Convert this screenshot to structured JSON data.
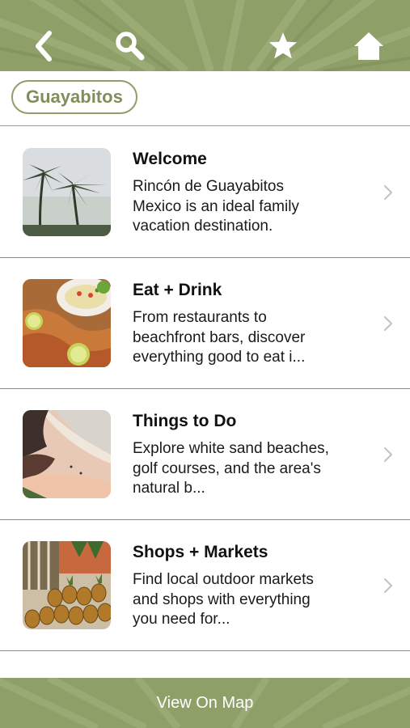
{
  "header": {
    "icons": [
      "back-icon",
      "search-icon",
      "star-icon",
      "home-icon"
    ],
    "background_color": "#8e9f68"
  },
  "filter_chip": {
    "label": "Guayabitos",
    "color": "#8e9f68"
  },
  "items": [
    {
      "title": "Welcome",
      "description": "Rincón de Guayabitos Mexico is an ideal family vacation destination.",
      "image": "palm-trees-photo"
    },
    {
      "title": "Eat + Drink",
      "description": "From restaurants to beachfront bars, discover everything good to eat i...",
      "image": "seafood-dish-photo"
    },
    {
      "title": "Things to Do",
      "description": "Explore white sand beaches, golf courses, and the area's natural b...",
      "image": "beach-coastline-photo"
    },
    {
      "title": "Shops + Markets",
      "description": "Find local outdoor markets and shops with everything you need for...",
      "image": "pineapples-market-photo"
    }
  ],
  "footer": {
    "label": "View On Map"
  }
}
